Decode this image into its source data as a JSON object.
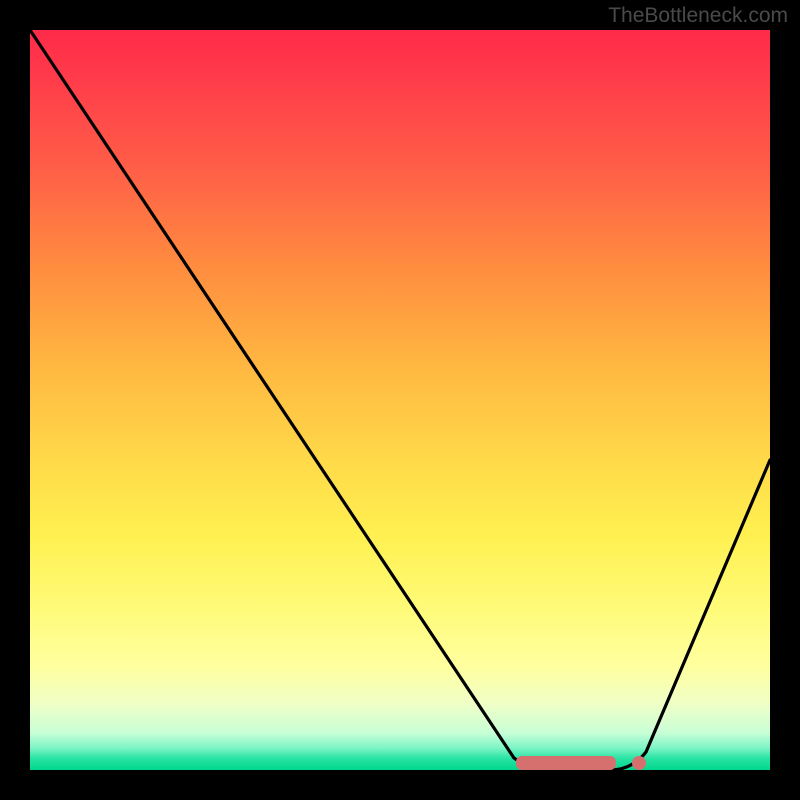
{
  "watermark": "TheBottleneck.com",
  "chart_data": {
    "type": "line",
    "title": "",
    "xlabel": "",
    "ylabel": "",
    "xlim": [
      0,
      100
    ],
    "ylim": [
      0,
      100
    ],
    "background_gradient": {
      "top": "#ff2a4a",
      "bottom": "#00d78e",
      "stops": [
        "red",
        "orange",
        "yellow",
        "green"
      ]
    },
    "curve": {
      "description": "V-shaped bottleneck curve: steep descent from top-left to a flat minimum around x=70-80, then rising toward the right edge",
      "x": [
        0,
        10,
        20,
        30,
        40,
        50,
        60,
        66,
        70,
        74,
        78,
        82,
        86,
        90,
        95,
        100
      ],
      "y": [
        100,
        86,
        71,
        57,
        43,
        29,
        15,
        4,
        1,
        0,
        0,
        1,
        5,
        14,
        28,
        43
      ]
    },
    "valley_marker": {
      "x_start": 66,
      "x_end": 82,
      "y": 0,
      "color": "#d6706f"
    }
  }
}
